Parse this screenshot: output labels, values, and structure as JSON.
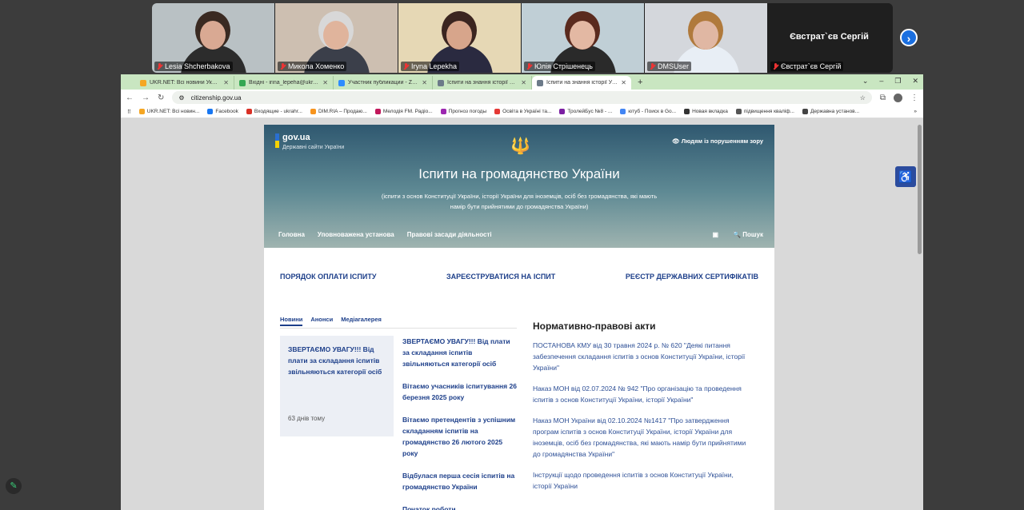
{
  "zoom": {
    "participants": [
      {
        "name": "Lesia Shcherbakova",
        "bg": "#b9c1c4",
        "skin": "#d9a993",
        "hair": "#3a2a22",
        "shirt": "#2c2c2c"
      },
      {
        "name": "Микола Хоменко",
        "bg": "#cdbfb1",
        "skin": "#e0b49c",
        "hair": "#d8d8d8",
        "shirt": "#3b3f4a"
      },
      {
        "name": "Iryna Lepekha",
        "bg": "#e6d8b5",
        "skin": "#d7a58b",
        "hair": "#3b2520",
        "shirt": "#2a2a40"
      },
      {
        "name": "Юлія Стрішенець",
        "bg": "#c0cfd6",
        "skin": "#e3b8a3",
        "hair": "#5a2a1e",
        "shirt": "#2a2a2a"
      },
      {
        "name": "DMSUser",
        "bg": "#d4d7dc",
        "skin": "#e0b7a3",
        "hair": "#b07a3c",
        "shirt": "#e8eef5"
      }
    ],
    "namecard": {
      "big": "Євстрат`єв Сергій",
      "label": "Євстрат`єв Сергій"
    },
    "next_icon": "chevron-right-icon"
  },
  "browser": {
    "tabs": [
      {
        "title": "UKR.NET: Всі новини України,",
        "color": "#f5a623"
      },
      {
        "title": "Вхідні - irina_lepeha@ukr.net",
        "color": "#34a853"
      },
      {
        "title": "Участник публикации - Zoom",
        "color": "#2d8cff"
      },
      {
        "title": "Іспити на знання історії України",
        "color": "#6c7a89"
      },
      {
        "title": "Іспити на знання історії Украї",
        "color": "#6c7a89"
      }
    ],
    "url": "citizenship.gov.ua",
    "bookmarks": [
      {
        "label": "UKR.NET: Всі новин...",
        "color": "#f5a623"
      },
      {
        "label": "Facebook",
        "color": "#1877f2"
      },
      {
        "label": "Входящие - ukrahr...",
        "color": "#d93025"
      },
      {
        "label": "DIM.RIA – Продаю...",
        "color": "#f7941d"
      },
      {
        "label": "Мелодія FM. Радіо...",
        "color": "#c2185b"
      },
      {
        "label": "Прогноз погоды",
        "color": "#9c27b0"
      },
      {
        "label": "Освіта в Україні та...",
        "color": "#e53935"
      },
      {
        "label": "ТролейБус №8 - ...",
        "color": "#7b1fa2"
      },
      {
        "label": "ютуб - Поиск в Go...",
        "color": "#4285f4"
      },
      {
        "label": "Новая вкладка",
        "color": "#333333"
      },
      {
        "label": "підвищення кваліф...",
        "color": "#555555"
      },
      {
        "label": "Державна установ...",
        "color": "#444444"
      }
    ]
  },
  "site": {
    "gov_label": "gov.ua",
    "gov_sub": "Державні сайти України",
    "vision_label": "Людям із порушенням зору",
    "title": "Іспити на громадянство України",
    "subtitle": "(іспити з основ Конституції України, історії України для іноземців,  осіб без громадянства, які мають намір бути прийнятими до громадянства України)",
    "nav": [
      "Головна",
      "Уповноважена установа",
      "Правові засади діяльності"
    ],
    "search_label": "Пошук",
    "quick_links": [
      "ПОРЯДОК ОПЛАТИ ІСПИТУ",
      "ЗАРЕЄСТРУВАТИСЯ НА ІСПИТ",
      "РЕЄСТР ДЕРЖАВНИХ СЕРТИФІКАТІВ"
    ],
    "news_tabs": [
      "Новини",
      "Анонси",
      "Медіагалерея"
    ],
    "featured": {
      "title": "ЗВЕРТАЄМО УВАГУ!!! Від плати за складання іспитів звільняються категорії осіб",
      "age": "63 днів тому"
    },
    "news": [
      "ЗВЕРТАЄМО УВАГУ!!! Від плати за складання іспитів звільняються категорії осіб",
      "Вітаємо учасників іспитування 26 березня 2025 року",
      "Вітаємо претендентів з успішним складанням іспитів на громадянство 26 лютого 2025 року",
      "Відбулася перша сесія іспитів на громадянство України",
      "Початок роботи"
    ],
    "normative_title": "Нормативно-правові акти",
    "acts": [
      "ПОСТАНОВА КМУ від 30 травня 2024 р. № 620 \"Деякі питання забезпечення складання іспитів з основ Конституції України, історії України\"",
      "Наказ МОН від 02.07.2024 № 942 \"Про організацію та проведення іспитів з основ Конституції України, історії України\"",
      "Наказ МОН України від 02.10.2024 №1417 \"Про затвердження програм іспитів з основ Конституції України, історії України для іноземців, осіб без громадянства, які мають намір бути прийнятими до громадянства України\"",
      "Інструкції щодо проведення іспитів з основ Конституції України, історії України"
    ]
  }
}
